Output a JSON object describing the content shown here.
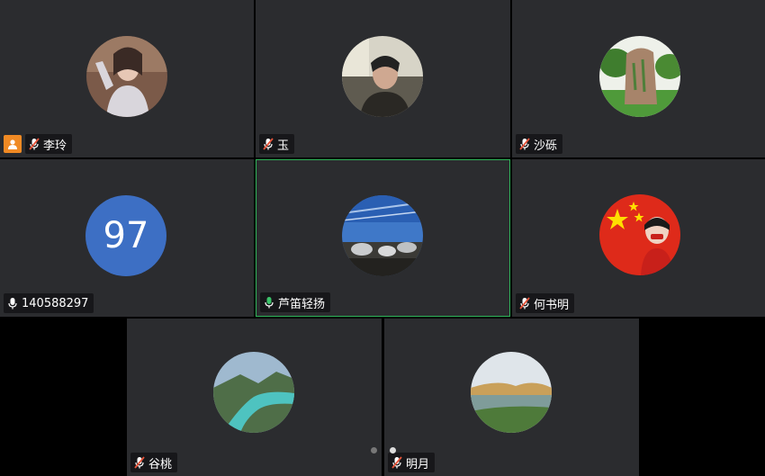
{
  "participants": [
    {
      "name": "李玲",
      "mic": "muted",
      "host": true
    },
    {
      "name": "玉",
      "mic": "muted"
    },
    {
      "name": "沙砾",
      "mic": "muted"
    },
    {
      "name": "140588297",
      "mic": "on",
      "initials": "97"
    },
    {
      "name": "芦笛轻扬",
      "mic": "active",
      "active_speaker": true
    },
    {
      "name": "何书明",
      "mic": "muted"
    },
    {
      "name": "谷桃",
      "mic": "muted"
    },
    {
      "name": "明月",
      "mic": "muted"
    }
  ],
  "icons": {
    "host": "host-person-icon",
    "mic_muted": "mic-muted-icon",
    "mic_on": "mic-icon"
  },
  "colors": {
    "tile_bg": "#2b2c2f",
    "active_border": "#2fb45a",
    "host_badge": "#f08a24",
    "mic_muted": "#e8543a",
    "mic_active": "#3cc36a",
    "initials_bg": "#3d6fc4"
  },
  "pagination": {
    "pages": 2,
    "current": 2
  }
}
